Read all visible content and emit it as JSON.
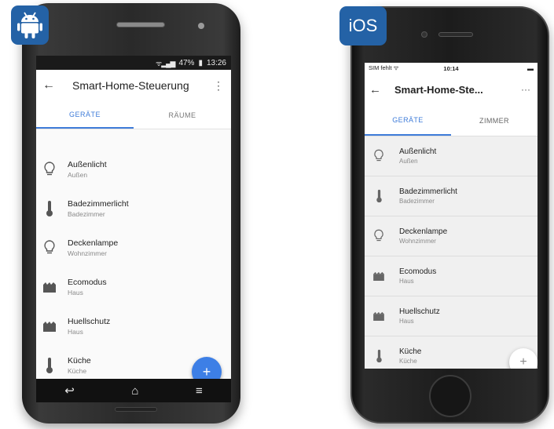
{
  "colors": {
    "accent": "#3f7cd9",
    "badge": "#2462a6",
    "android_fab": "#3d7fe6"
  },
  "android": {
    "statusbar": {
      "signal": "wifi-signal",
      "battery": "47%",
      "time": "13:26"
    },
    "appbar": {
      "back_icon": "arrow-left-icon",
      "title": "Smart-Home-Steuerung",
      "menu_icon": "more-vert-icon"
    },
    "tabs": [
      {
        "label": "GERÄTE",
        "active": true
      },
      {
        "label": "RÄUME",
        "active": false
      }
    ],
    "items": [
      {
        "name": "Außenlicht",
        "sub": "Außen",
        "icon": "bulb-icon"
      },
      {
        "name": "Badezimmerlicht",
        "sub": "Badezimmer",
        "icon": "thermometer-icon"
      },
      {
        "name": "Deckenlampe",
        "sub": "Wohnzimmer",
        "icon": "bulb-icon"
      },
      {
        "name": "Ecomodus",
        "sub": "Haus",
        "icon": "scene-icon"
      },
      {
        "name": "Huellschutz",
        "sub": "Haus",
        "icon": "scene-icon"
      },
      {
        "name": "Küche",
        "sub": "Küche",
        "icon": "thermometer-icon"
      }
    ],
    "fab_label": "+"
  },
  "ios": {
    "badge_label": "iOS",
    "statusbar": {
      "carrier": "SIM fehlt ᯤ",
      "time": "10:14",
      "battery": "▬"
    },
    "navbar": {
      "back_icon": "arrow-left-icon",
      "title": "Smart-Home-Ste...",
      "more_icon": "more-horiz-icon"
    },
    "tabs": [
      {
        "label": "GERÄTE",
        "active": true
      },
      {
        "label": "ZIMMER",
        "active": false
      }
    ],
    "items": [
      {
        "name": "Außenlicht",
        "sub": "Außen",
        "icon": "bulb-icon"
      },
      {
        "name": "Badezimmerlicht",
        "sub": "Badezimmer",
        "icon": "thermometer-icon"
      },
      {
        "name": "Deckenlampe",
        "sub": "Wohnzimmer",
        "icon": "bulb-icon"
      },
      {
        "name": "Ecomodus",
        "sub": "Haus",
        "icon": "scene-icon"
      },
      {
        "name": "Huellschutz",
        "sub": "Haus",
        "icon": "scene-icon"
      },
      {
        "name": "Küche",
        "sub": "Küche",
        "icon": "thermometer-icon"
      }
    ],
    "fab_label": "+"
  }
}
